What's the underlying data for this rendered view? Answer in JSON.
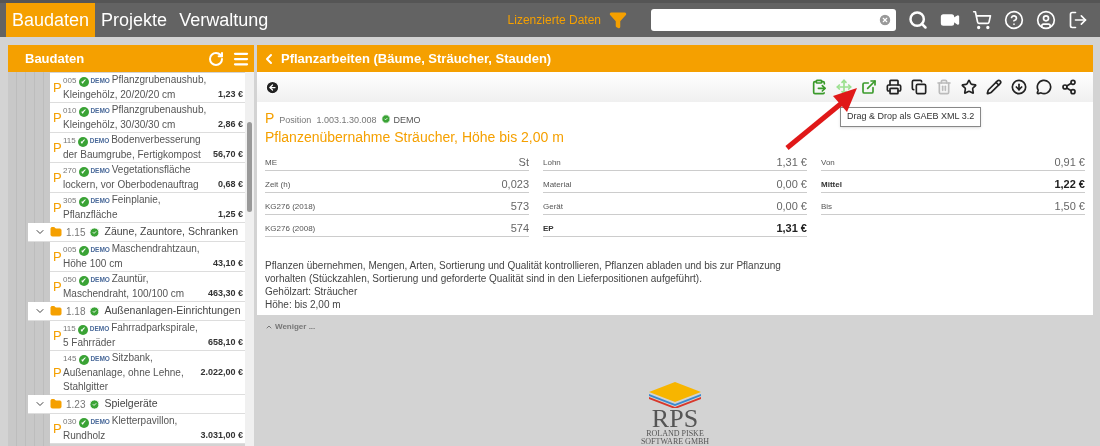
{
  "nav": {
    "tabs": [
      {
        "label": "Baudaten",
        "selected": true
      },
      {
        "label": "Projekte",
        "selected": false
      },
      {
        "label": "Verwaltung",
        "selected": false
      }
    ],
    "licensed_label": "Lizenzierte Daten"
  },
  "sidebar": {
    "title": "Baudaten",
    "tree": [
      {
        "kind": "item",
        "type_letter": "P",
        "code": "005",
        "status_icon": "✔",
        "badge": "DEMO",
        "title": "Pflanzgrubenaushub, Kleingehölz, 20/20/20 cm",
        "price": "1,23 €"
      },
      {
        "kind": "item",
        "type_letter": "P",
        "code": "010",
        "status_icon": "✔",
        "badge": "DEMO",
        "title": "Pflanzgrubenaushub, Kleingehölz, 30/30/30 cm",
        "price": "2,86 €"
      },
      {
        "kind": "item",
        "type_letter": "P",
        "code": "115",
        "status_icon": "✔",
        "badge": "DEMO",
        "title": "Bodenverbesserung der Baumgrube, Fertigkompost",
        "price": "56,70 €"
      },
      {
        "kind": "item",
        "type_letter": "P",
        "code": "270",
        "status_icon": "✔",
        "badge": "DEMO",
        "title": "Vegetationsfläche lockern, vor Oberbodenauftrag",
        "price": "0,68 €"
      },
      {
        "kind": "item",
        "type_letter": "P",
        "code": "305",
        "status_icon": "✔",
        "badge": "DEMO",
        "title": "Feinplanie, Pflanzfläche",
        "price": "1,25 €"
      },
      {
        "kind": "group",
        "code": "1.15",
        "title": "Zäune, Zauntore, Schranken",
        "expanded": true,
        "children": [
          {
            "kind": "item",
            "type_letter": "P",
            "code": "005",
            "status_icon": "✔",
            "badge": "DEMO",
            "title": "Maschendrahtzaun, Höhe 100 cm",
            "price": "43,10 €"
          },
          {
            "kind": "item",
            "type_letter": "P",
            "code": "050",
            "status_icon": "✔",
            "badge": "DEMO",
            "title": "Zauntür, Maschendraht, 100/100 cm",
            "price": "463,30 €"
          }
        ]
      },
      {
        "kind": "group",
        "code": "1.18",
        "title": "Außenanlagen-Einrichtungen",
        "expanded": true,
        "children": [
          {
            "kind": "item",
            "type_letter": "P",
            "code": "115",
            "status_icon": "✔",
            "badge": "DEMO",
            "title": "Fahrradparkspirale, 5 Fahrräder",
            "price": "658,10 €"
          },
          {
            "kind": "item",
            "type_letter": "P",
            "code": "145",
            "status_icon": "✔",
            "badge": "DEMO",
            "title": "Sitzbank, Außenanlage, ohne Lehne, Stahlgitter",
            "price": "2.022,00 €"
          }
        ]
      },
      {
        "kind": "group",
        "code": "1.23",
        "title": "Spielgeräte",
        "expanded": true,
        "children": [
          {
            "kind": "item",
            "type_letter": "P",
            "code": "030",
            "status_icon": "✔",
            "badge": "DEMO",
            "title": "Kletterpavillon, Rundholz",
            "price": "3.031,00 €"
          }
        ]
      }
    ]
  },
  "detail": {
    "header": "Pflanzarbeiten (Bäume, Sträucher, Stauden)",
    "toolbar": [
      {
        "kind": "paste",
        "disabled": false
      },
      {
        "kind": "move",
        "disabled": false
      },
      {
        "kind": "export",
        "disabled": false
      },
      {
        "kind": "print",
        "disabled": false
      },
      {
        "kind": "copy",
        "disabled": false
      },
      {
        "kind": "delete",
        "disabled": true
      },
      {
        "kind": "favorite",
        "disabled": false
      },
      {
        "kind": "edit",
        "disabled": false
      },
      {
        "kind": "download",
        "disabled": false
      },
      {
        "kind": "comment",
        "disabled": false
      },
      {
        "kind": "share",
        "disabled": false
      }
    ],
    "tooltip": "Drag & Drop als GAEB XML 3.2",
    "type_letter": "P",
    "position_label": "Position",
    "position_number": "1.003.1.30.008",
    "badge": "DEMO",
    "title": "Pflanzenübernahme Sträucher, Höhe bis 2,00 m",
    "tables": [
      [
        {
          "label": "ME",
          "value": "St",
          "emphasis": false
        },
        {
          "label": "Zeit (h)",
          "value": "0,023",
          "emphasis": false
        },
        {
          "label": "KG276 (2018)",
          "value": "573",
          "emphasis": false
        },
        {
          "label": "KG276 (2008)",
          "value": "574",
          "emphasis": false
        }
      ],
      [
        {
          "label": "Lohn",
          "value": "1,31 €",
          "emphasis": false
        },
        {
          "label": "Material",
          "value": "0,00 €",
          "emphasis": false
        },
        {
          "label": "Gerät",
          "value": "0,00 €",
          "emphasis": false
        },
        {
          "label": "EP",
          "value": "1,31 €",
          "emphasis": true
        }
      ],
      [
        {
          "label": "Von",
          "value": "0,91 €",
          "emphasis": false
        },
        {
          "label": "Mittel",
          "value": "1,22 €",
          "emphasis": true
        },
        {
          "label": "Bis",
          "value": "1,50 €",
          "emphasis": false
        }
      ]
    ],
    "description": [
      "Pflanzen übernehmen, Mengen, Arten, Sortierung und Qualität kontrollieren, Pflanzen abladen und bis zur Pflanzung vorhalten (Stückzahlen, Sortierung und geforderte Qualität sind in den Lieferpositionen aufgeführt).",
      "Gehölzart: Sträucher",
      "Höhe: bis 2,00 m"
    ],
    "less_link": "Weniger ..."
  },
  "logo": {
    "name": "RPS",
    "line1": "ROLAND PISKE",
    "line2": "SOFTWARE GMBH"
  }
}
